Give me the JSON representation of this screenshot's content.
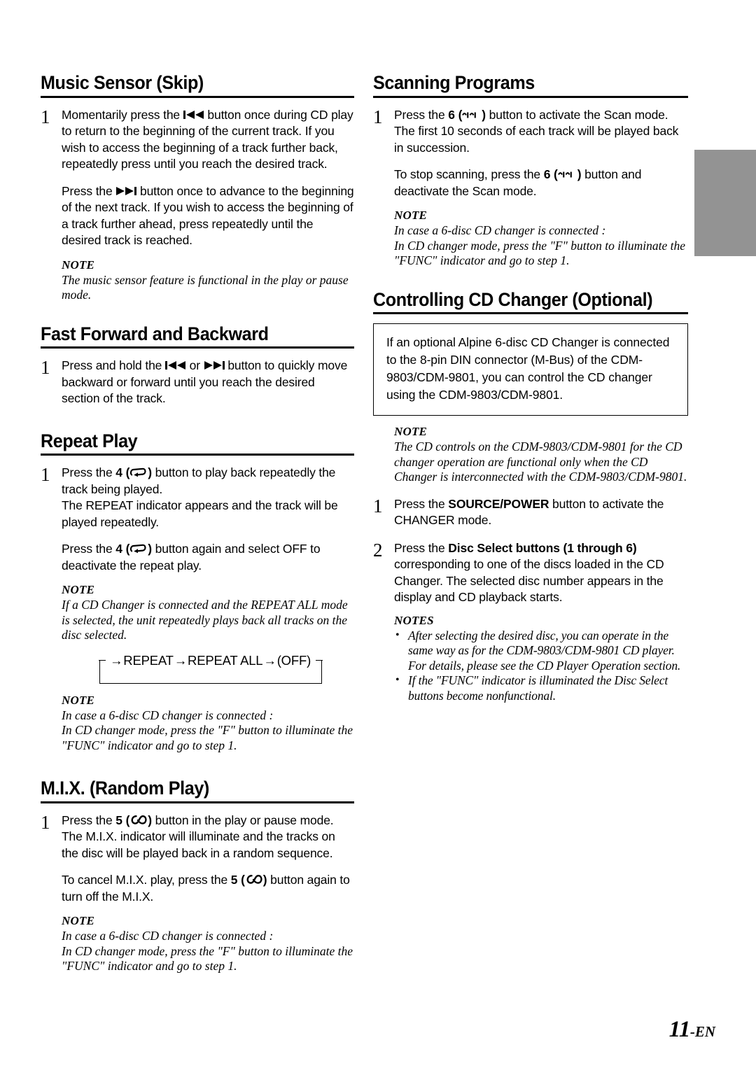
{
  "page": {
    "folio_number": "11",
    "folio_suffix": "-EN",
    "edge_tab_color": "#939393"
  },
  "left_column": {
    "sections": [
      {
        "id": "music-sensor",
        "heading": "Music Sensor (Skip)",
        "steps": [
          {
            "number": "1",
            "paragraphs": [
              "Momentarily press the ◀ button once during CD play to return to the beginning of the current track. If you wish to access the beginning of a track further back, repeatedly press until you reach the desired track.",
              "Press the ▶ button once to advance to the beginning of the next track. If you wish to access the beginning of a track further ahead, press repeatedly until the desired track is reached."
            ]
          }
        ],
        "note": {
          "title": "NOTE",
          "lines": [
            "The music sensor feature is functional in the play or pause mode."
          ]
        }
      },
      {
        "id": "fast-forward-backward",
        "heading": "Fast Forward and Backward",
        "steps": [
          {
            "number": "1",
            "paragraphs": [
              "Press and hold the ◀ or ▶ button to quickly move backward or forward until you reach the desired section of the track."
            ]
          }
        ]
      },
      {
        "id": "repeat-play",
        "heading": "Repeat Play",
        "steps": [
          {
            "number": "1",
            "paragraphs": [
              "Press the 4 (↻) button to play back repeatedly the track being played.",
              "The REPEAT indicator appears and the track will be played repeatedly.",
              "Press the 4 (↻) button again and select OFF to deactivate the repeat play."
            ]
          }
        ],
        "note": {
          "title": "NOTE",
          "lines": [
            "If a CD Changer is connected and the REPEAT ALL mode is selected, the unit repeatedly plays back all tracks on the disc selected."
          ]
        },
        "cycle_diagram": {
          "items": [
            "REPEAT",
            "REPEAT ALL",
            "(OFF)"
          ],
          "arrow": "→"
        },
        "note2": {
          "title": "NOTE",
          "lines": [
            "In case a 6-disc CD changer is connected :",
            "In CD changer mode, press the \"F\" button to illuminate the \"FUNC\" indicator and go to step 1."
          ]
        }
      },
      {
        "id": "mix-random-play",
        "heading": "M.I.X. (Random Play)",
        "steps": [
          {
            "number": "1",
            "paragraphs": [
              "Press the 5 (M.I.X.) button in the play or pause mode.",
              "The M.I.X. indicator will illuminate and the tracks on the disc will be played back in a random sequence.",
              "To cancel M.I.X. play, press the 5 (M.I.X.) button again to turn off the M.I.X."
            ]
          }
        ],
        "note": {
          "title": "NOTE",
          "lines": [
            "In case a 6-disc CD changer is connected :",
            "In CD changer mode, press the \"F\" button to illuminate the \"FUNC\" indicator and go to step 1."
          ]
        }
      }
    ]
  },
  "right_column": {
    "sections": [
      {
        "id": "scanning-programs",
        "heading": "Scanning Programs",
        "steps": [
          {
            "number": "1",
            "paragraphs": [
              "Press the 6 (SCAN) button to activate the Scan mode.",
              "The first 10 seconds of each track will be played back in succession.",
              "To stop scanning, press the 6 (SCAN) button and deactivate the Scan mode."
            ]
          }
        ],
        "note": {
          "title": "NOTE",
          "lines": [
            "In case a 6-disc CD changer is connected :",
            "In CD changer mode, press the \"F\" button to illuminate the \"FUNC\" indicator and go to step 1."
          ]
        }
      },
      {
        "id": "controlling-cd-changer",
        "heading": "Controlling CD Changer (Optional)",
        "info_box": "If an optional Alpine 6-disc CD Changer is connected to the 8-pin DIN connector (M-Bus) of the CDM-9803/CDM-9801, you can control the CD changer using the CDM-9803/CDM-9801.",
        "note": {
          "title": "NOTE",
          "lines": [
            "The CD controls on the CDM-9803/CDM-9801 for the CD changer operation are functional only when the CD Changer is interconnected with the CDM-9803/CDM-9801."
          ]
        },
        "steps": [
          {
            "number": "1",
            "text_before": "Press the ",
            "bold": "SOURCE/POWER",
            "text_after": " button to activate the CHANGER mode."
          },
          {
            "number": "2",
            "text_before": "Press the ",
            "bold": "Disc Select buttons (1 through 6)",
            "text_after": " corresponding to one of the discs loaded in the CD Changer. The selected disc number appears in the display and CD playback starts."
          }
        ],
        "notes": {
          "title": "NOTES",
          "items": [
            [
              "After selecting the desired disc, you can operate in the same way as for the CDM-9803/CDM-9801 CD player.",
              "For details, please see the CD Player Operation section."
            ],
            [
              "If the \"FUNC\" indicator is illuminated the Disc Select buttons become nonfunctional."
            ]
          ]
        }
      }
    ]
  }
}
